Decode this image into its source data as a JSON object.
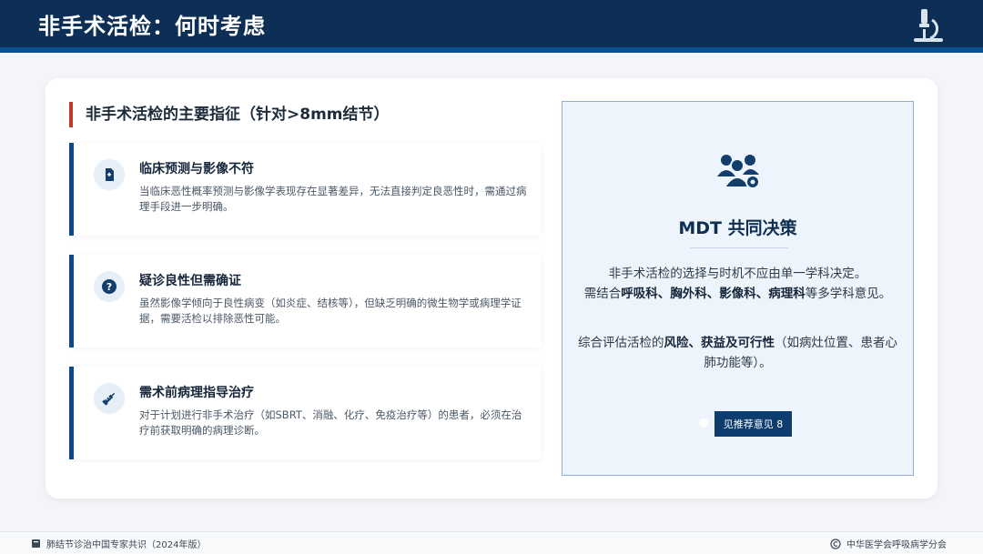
{
  "header": {
    "title": "非手术活检：何时考虑",
    "logo_icon": "microscope-icon"
  },
  "section": {
    "title": "非手术活检的主要指征（针对>8mm结节）"
  },
  "cards": [
    {
      "icon": "file-medical-icon",
      "title": "临床预测与影像不符",
      "text": "当临床恶性概率预测与影像学表现存在显著差异，无法直接判定良恶性时，需通过病理手段进一步明确。"
    },
    {
      "icon": "question-circle-icon",
      "title": "疑诊良性但需确证",
      "text": "虽然影像学倾向于良性病变（如炎症、结核等），但缺乏明确的微生物学或病理学证据，需要活检以排除恶性可能。"
    },
    {
      "icon": "syringe-icon",
      "title": "需术前病理指导治疗",
      "text": "对于计划进行非手术治疗（如SBRT、消融、化疗、免疫治疗等）的患者，必须在治疗前获取明确的病理诊断。"
    }
  ],
  "mdt": {
    "icon": "team-settings-icon",
    "title": "MDT 共同决策",
    "p1_line1": "非手术活检的选择与时机不应由单一学科决定。",
    "p1_pre": "需结合",
    "p1_bold": "呼吸科、胸外科、影像科、病理科",
    "p1_post": "等多学科意见。",
    "p2_pre": "综合评估活检的",
    "p2_bold": "风险、获益及可行性",
    "p2_post": "（如病灶位置、患者心肺功能等）。",
    "button_label": "见推荐意见 8"
  },
  "footer": {
    "left_text": "肺结节诊治中国专家共识（2024年版）",
    "right_text": "中华医学会呼吸病学分会",
    "left_icon": "book-icon",
    "right_icon": "copyright-icon"
  },
  "colors": {
    "header_bg": "#0d2f55",
    "accent_red": "#c0392b",
    "card_border": "#0d4a85",
    "button_bg": "#0d3d6e"
  }
}
